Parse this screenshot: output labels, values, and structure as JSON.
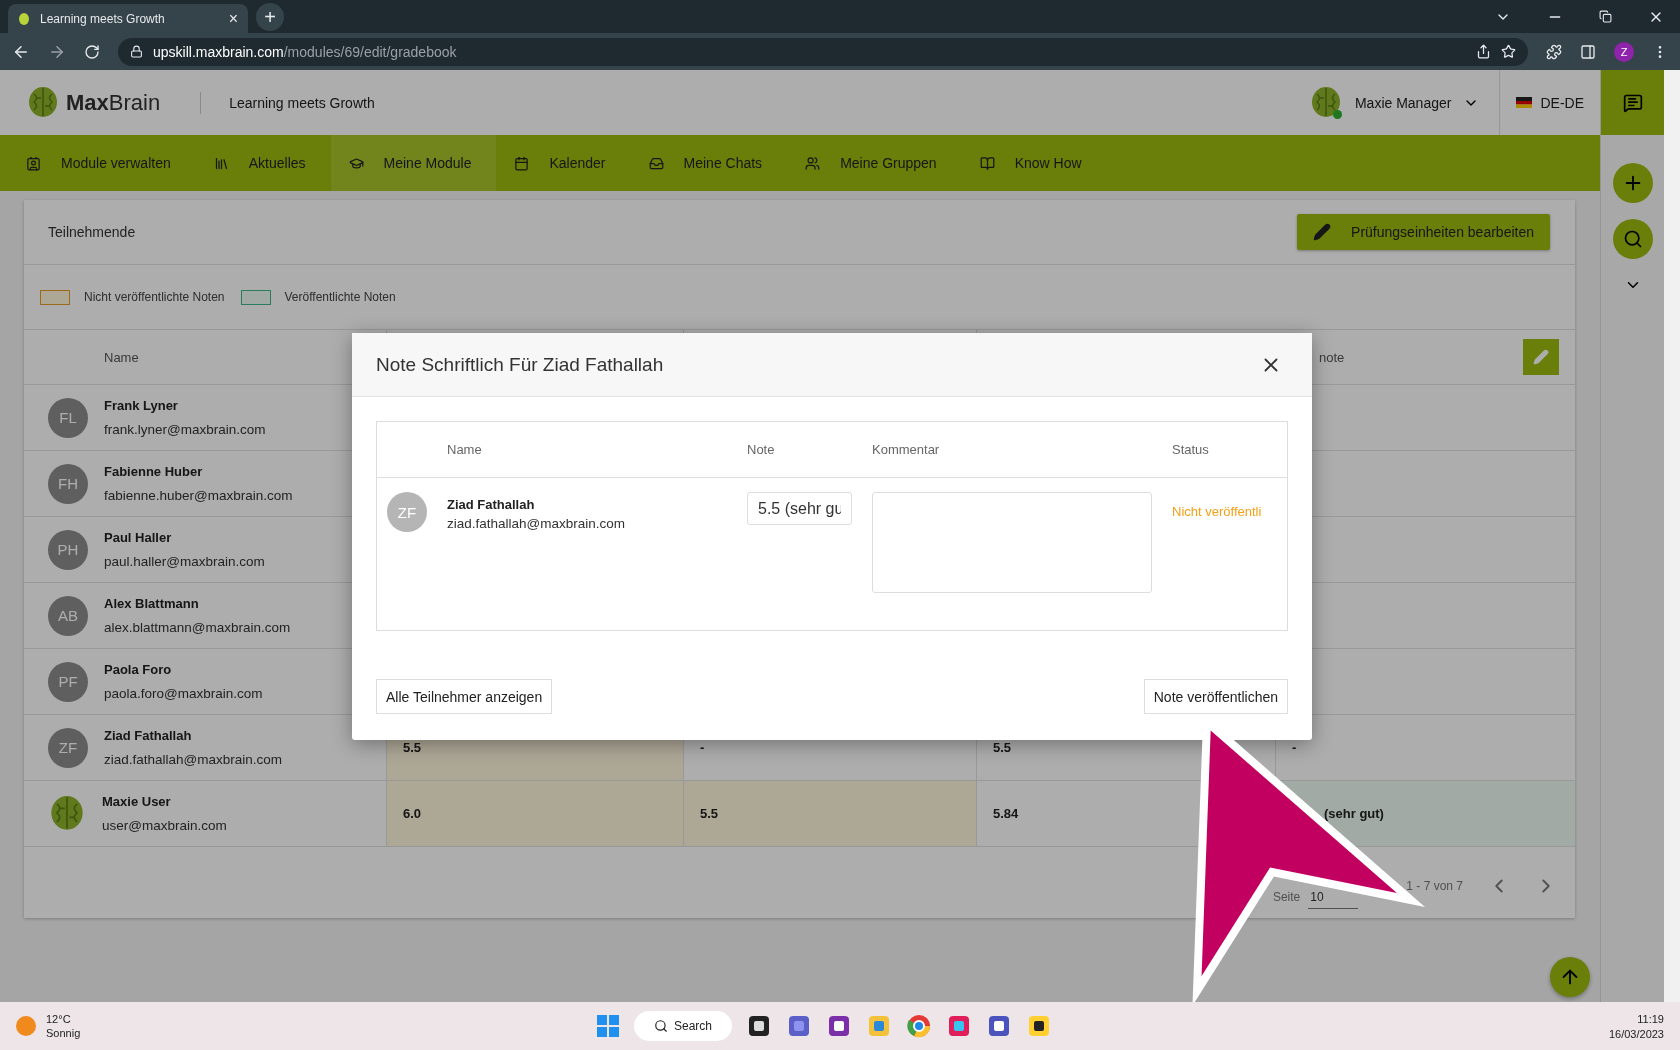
{
  "browser": {
    "tab_title": "Learning meets Growth",
    "tab_close": "×",
    "new_tab": "+",
    "url_domain": "upskill.maxbrain.com",
    "url_path": "/modules/69/edit/gradebook",
    "profile_initial": "Z"
  },
  "header": {
    "logo_text": "**Max**Brain",
    "tagline": "Learning meets Growth",
    "user_name": "Maxie Manager",
    "user_online": true,
    "language": "DE-DE"
  },
  "nav": [
    {
      "label": "Module verwalten",
      "selected": false
    },
    {
      "label": "Aktuelles",
      "selected": false
    },
    {
      "label": "Meine Module",
      "selected": true
    },
    {
      "label": "Kalender",
      "selected": false
    },
    {
      "label": "Meine Chats",
      "selected": false
    },
    {
      "label": "Meine Gruppen",
      "selected": false
    },
    {
      "label": "Know How",
      "selected": false
    }
  ],
  "card": {
    "title": "Teilnehmende",
    "edit_button": "Prüfungseinheiten bearbeiten",
    "legend": [
      {
        "label": "Nicht veröffentlichte Noten",
        "kind": "unpublished"
      },
      {
        "label": "Veröffentlichte Noten",
        "kind": "published"
      }
    ],
    "name_header": "Name",
    "last_header": "note",
    "rows": [
      {
        "kind": "initials",
        "initials": "FL",
        "name": "Frank Lyner",
        "email": "frank.lyner@maxbrain.com"
      },
      {
        "kind": "initials",
        "initials": "FH",
        "name": "Fabienne Huber",
        "email": "fabienne.huber@maxbrain.com"
      },
      {
        "kind": "initials",
        "initials": "PH",
        "name": "Paul Haller",
        "email": "paul.haller@maxbrain.com"
      },
      {
        "kind": "initials",
        "initials": "AB",
        "name": "Alex Blattmann",
        "email": "alex.blattmann@maxbrain.com"
      },
      {
        "kind": "initials",
        "initials": "PF",
        "name": "Paola Foro",
        "email": "paola.foro@maxbrain.com"
      },
      {
        "kind": "initials",
        "initials": "ZF",
        "name": "Ziad Fathallah",
        "email": "ziad.fathallah@maxbrain.com",
        "cells": [
          {
            "text": "5.5",
            "kind": "unpublished"
          },
          {
            "text": "-",
            "kind": "plain"
          },
          {
            "text": "5.5",
            "kind": "plain"
          },
          {
            "text": "-",
            "kind": "plain"
          }
        ]
      },
      {
        "kind": "logo",
        "name": "Maxie User",
        "email": "user@maxbrain.com",
        "cells": [
          {
            "text": "6.0",
            "kind": "unpublished"
          },
          {
            "text": "5.5",
            "kind": "unpublished"
          },
          {
            "text": "5.84",
            "kind": "plain"
          },
          {
            "text": "(sehr gut)",
            "kind": "published"
          }
        ]
      }
    ],
    "pagination": {
      "per_page_label": "Seite",
      "per_page": "10",
      "range": "1 - 7 von 7"
    }
  },
  "dialog": {
    "title": "Note Schriftlich Für Ziad Fathallah",
    "columns": [
      "Name",
      "Note",
      "Kommentar",
      "Status"
    ],
    "student": {
      "initials": "ZF",
      "name": "Ziad Fathallah",
      "email": "ziad.fathallah@maxbrain.com",
      "grade": "5.5 (sehr gu",
      "status": "Nicht veröffentli",
      "published": false
    },
    "buttons": [
      "Alle Teilnehmer anzeigen",
      "Note veröffentlichen"
    ]
  },
  "taskbar": {
    "temperature": "12°C",
    "weather": "Sonnig",
    "search": "Search",
    "time": "11:19",
    "date": "16/03/2023"
  }
}
